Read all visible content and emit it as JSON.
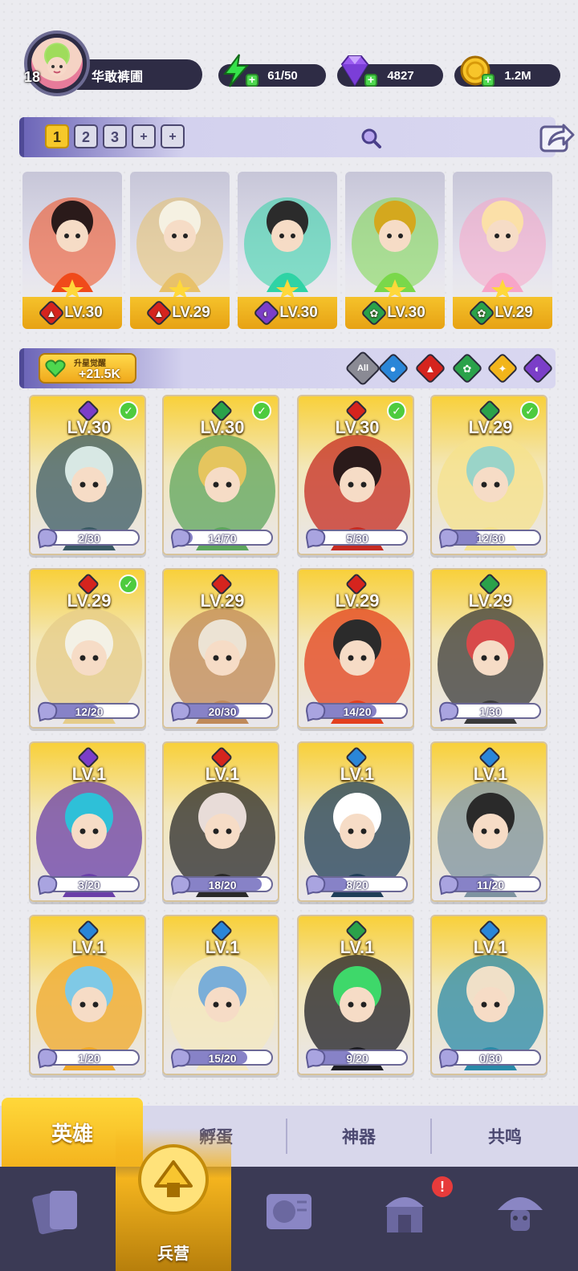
{
  "player": {
    "level": "18",
    "name": "华敢裤圃",
    "energy": "61/50",
    "gems": "4827",
    "gold": "1.2M"
  },
  "team_tabs": [
    "1",
    "2",
    "3",
    "+",
    "+"
  ],
  "team": [
    {
      "element": "fire",
      "level": "LV.30",
      "colors": [
        "#f04a1a",
        "#2a1a1a"
      ]
    },
    {
      "element": "fire",
      "level": "LV.29",
      "colors": [
        "#e8c16a",
        "#f5f1e2"
      ]
    },
    {
      "element": "dark",
      "level": "LV.30",
      "colors": [
        "#2fd3a5",
        "#2b2b2b"
      ]
    },
    {
      "element": "nature",
      "level": "LV.30",
      "colors": [
        "#7ad84a",
        "#d4a81e"
      ]
    },
    {
      "element": "nature",
      "level": "LV.29",
      "colors": [
        "#f7a5c8",
        "#fbe0a8"
      ]
    }
  ],
  "awaken": {
    "title": "升星觉醒",
    "value": "+21.5K"
  },
  "filters": {
    "all_label": "All",
    "elements": [
      "water",
      "fire",
      "nature",
      "light",
      "dark"
    ]
  },
  "heroes": [
    {
      "level": "LV.30",
      "element": "dark",
      "shards": "2/30",
      "fill": 0.07,
      "checked": true,
      "colors": [
        "#3a5a64",
        "#d8e8e4"
      ]
    },
    {
      "level": "LV.30",
      "element": "nature",
      "shards": "14/70",
      "fill": 0.2,
      "checked": true,
      "colors": [
        "#5da65c",
        "#e5c55e"
      ]
    },
    {
      "level": "LV.30",
      "element": "fire",
      "shards": "5/30",
      "fill": 0.17,
      "checked": true,
      "colors": [
        "#c52b22",
        "#2a1a1a"
      ]
    },
    {
      "level": "LV.29",
      "element": "nature",
      "shards": "12/30",
      "fill": 0.4,
      "checked": true,
      "colors": [
        "#f5e28c",
        "#9ad4c8"
      ]
    },
    {
      "level": "LV.29",
      "element": "fire",
      "shards": "12/20",
      "fill": 0.6,
      "checked": true,
      "colors": [
        "#e5cc8a",
        "#f3f1e6"
      ]
    },
    {
      "level": "LV.29",
      "element": "fire",
      "shards": "20/30",
      "fill": 0.67,
      "checked": false,
      "colors": [
        "#c08a5a",
        "#ece3d4"
      ]
    },
    {
      "level": "LV.29",
      "element": "fire",
      "shards": "14/20",
      "fill": 0.7,
      "checked": false,
      "colors": [
        "#e3401e",
        "#2b2b2b"
      ]
    },
    {
      "level": "LV.29",
      "element": "nature",
      "shards": "1/30",
      "fill": 0.03,
      "checked": false,
      "colors": [
        "#3a3a3a",
        "#d84a4a"
      ]
    },
    {
      "level": "LV.1",
      "element": "dark",
      "shards": "3/20",
      "fill": 0.15,
      "checked": false,
      "colors": [
        "#6a3fa8",
        "#2ec0d8"
      ]
    },
    {
      "level": "LV.1",
      "element": "fire",
      "shards": "18/20",
      "fill": 0.9,
      "checked": false,
      "colors": [
        "#2a2a2a",
        "#e8dcd8"
      ]
    },
    {
      "level": "LV.1",
      "element": "water",
      "shards": "8/20",
      "fill": 0.4,
      "checked": false,
      "colors": [
        "#1f3e58",
        "#ffffff"
      ]
    },
    {
      "level": "LV.1",
      "element": "water",
      "shards": "11/20",
      "fill": 0.55,
      "checked": false,
      "colors": [
        "#7e93a0",
        "#2a2a2a"
      ]
    },
    {
      "level": "LV.1",
      "element": "water",
      "shards": "1/20",
      "fill": 0.05,
      "checked": false,
      "colors": [
        "#f0a828",
        "#7fc9e6"
      ]
    },
    {
      "level": "LV.1",
      "element": "water",
      "shards": "15/20",
      "fill": 0.75,
      "checked": false,
      "colors": [
        "#f4e8c0",
        "#7aaed8"
      ]
    },
    {
      "level": "LV.1",
      "element": "nature",
      "shards": "9/20",
      "fill": 0.45,
      "checked": false,
      "colors": [
        "#1e1e24",
        "#3ed86a"
      ]
    },
    {
      "level": "LV.1",
      "element": "water",
      "shards": "0/30",
      "fill": 0.0,
      "checked": false,
      "colors": [
        "#2a8aa8",
        "#f0e0c8"
      ]
    }
  ],
  "sub_tabs": [
    "英雄",
    "孵蛋",
    "神器",
    "共鸣"
  ],
  "nav": {
    "active_label": "兵营",
    "alert": "!"
  },
  "element_colors": {
    "fire": "#d5241e",
    "dark": "#7b3ec8",
    "nature": "#2aa24a",
    "water": "#2a86d8",
    "light": "#f2b51b"
  }
}
